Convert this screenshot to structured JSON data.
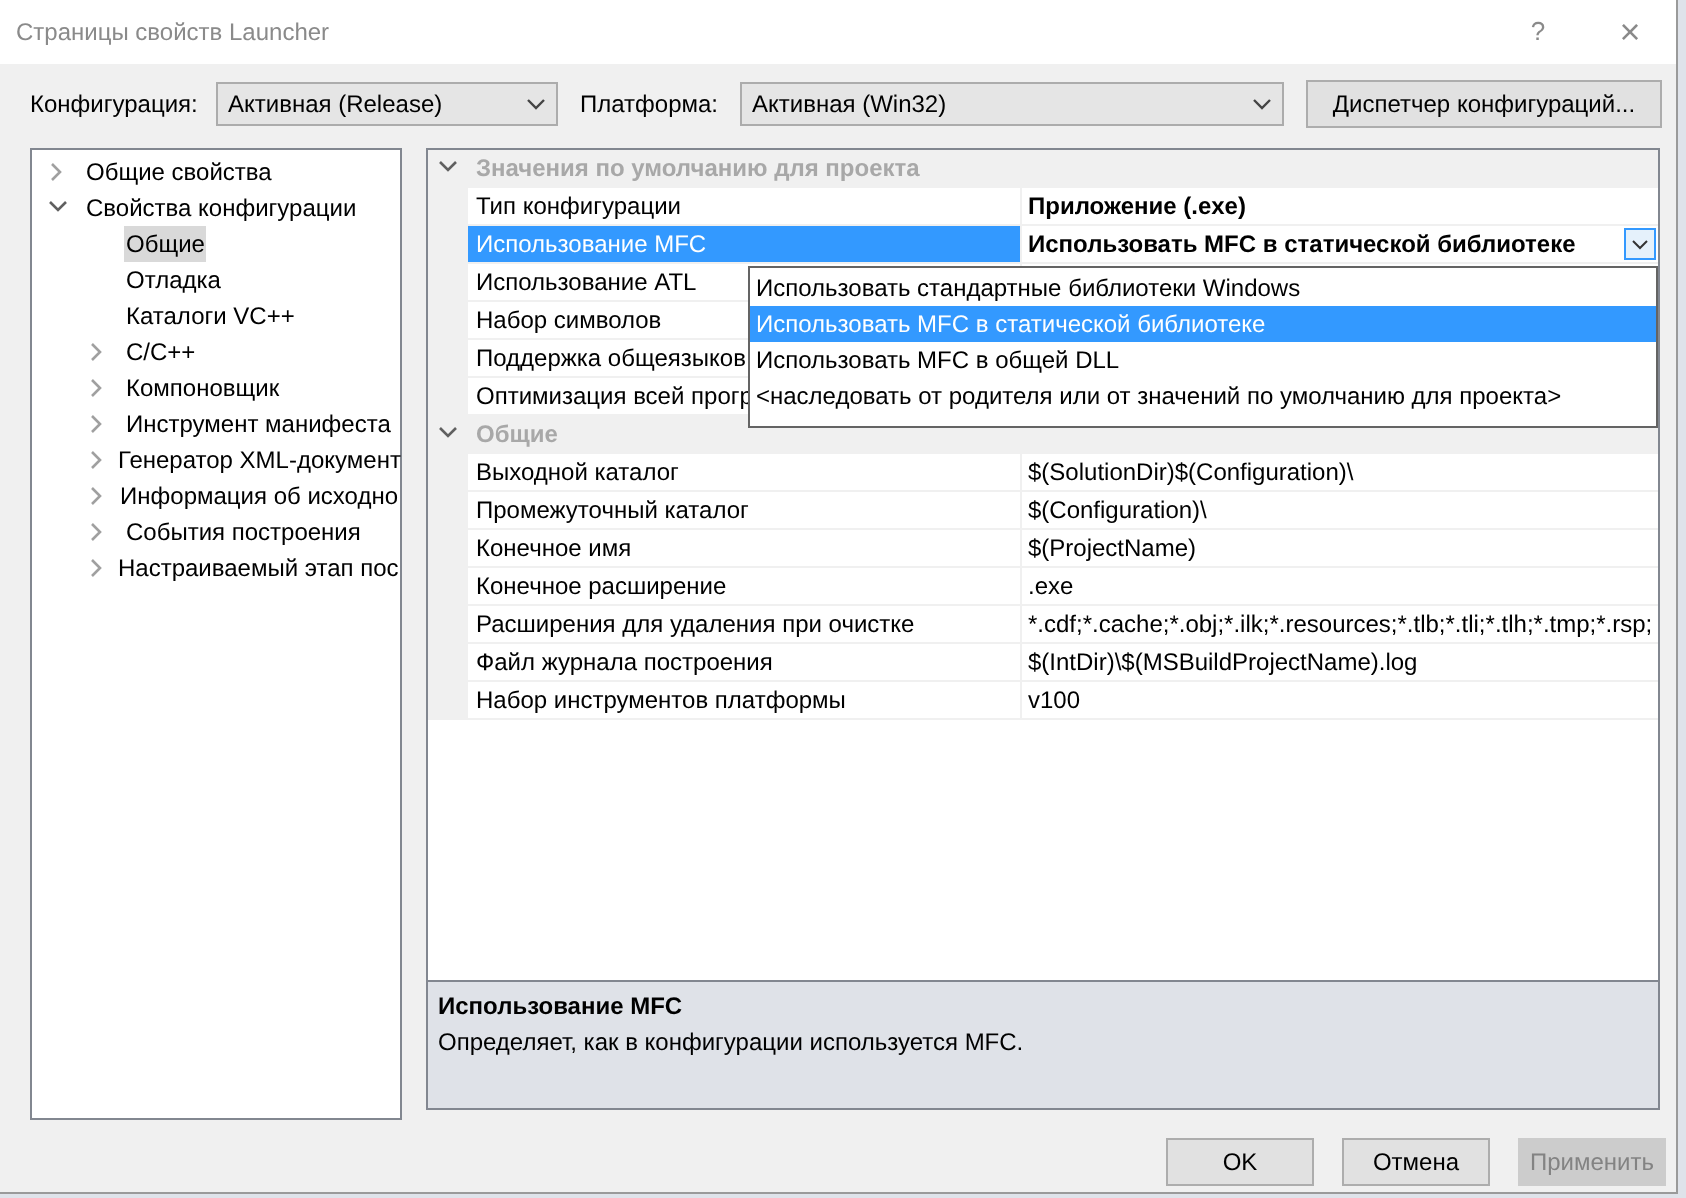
{
  "window": {
    "title": "Страницы свойств Launcher",
    "help": "?",
    "close": "×"
  },
  "toolbar": {
    "configuration_label": "Конфигурация:",
    "configuration": "Активная (Release)",
    "platform_label": "Платформа:",
    "platform": "Активная (Win32)",
    "manager_button": "Диспетчер конфигураций..."
  },
  "tree": [
    {
      "label": "Общие свойства",
      "expanded": false,
      "selected": false
    },
    {
      "label": "Свойства конфигурации",
      "expanded": true,
      "selected": false,
      "children": [
        {
          "label": "Общие",
          "selected": true
        },
        {
          "label": "Отладка",
          "selected": false
        },
        {
          "label": "Каталоги VC++",
          "selected": false
        },
        {
          "label": "C/C++",
          "expanded": false,
          "selected": false
        },
        {
          "label": "Компоновщик",
          "expanded": false,
          "selected": false
        },
        {
          "label": "Инструмент манифеста",
          "expanded": false,
          "selected": false
        },
        {
          "label": "Генератор XML-документ",
          "expanded": false,
          "selected": false
        },
        {
          "label": "Информация об исходно",
          "expanded": false,
          "selected": false
        },
        {
          "label": "События построения",
          "expanded": false,
          "selected": false
        },
        {
          "label": "Настраиваемый этап пос",
          "expanded": false,
          "selected": false
        }
      ]
    }
  ],
  "property_grid": {
    "sections": [
      {
        "title": "Значения по умолчанию для проекта",
        "expanded": true,
        "rows": [
          {
            "name": "Тип конфигурации",
            "value": "Приложение (.exe)",
            "modified": true,
            "selected": false
          },
          {
            "name": "Использование MFC",
            "value": "Использовать MFC в статической библиотеке",
            "modified": true,
            "selected": true
          },
          {
            "name": "Использование ATL",
            "selected": false
          },
          {
            "name": "Набор символов",
            "selected": false
          },
          {
            "name": "Поддержка общеязыков",
            "selected": false
          },
          {
            "name": "Оптимизация всей прогр",
            "selected": false
          }
        ]
      },
      {
        "title": "Общие",
        "expanded": true,
        "rows": [
          {
            "name": "Выходной каталог",
            "value": "$(SolutionDir)$(Configuration)\\",
            "modified": false,
            "selected": false
          },
          {
            "name": "Промежуточный каталог",
            "value": "$(Configuration)\\",
            "modified": false,
            "selected": false
          },
          {
            "name": "Конечное имя",
            "value": "$(ProjectName)",
            "modified": false,
            "selected": false
          },
          {
            "name": "Конечное расширение",
            "value": ".exe",
            "modified": false,
            "selected": false
          },
          {
            "name": "Расширения для удаления при очистке",
            "value": "*.cdf;*.cache;*.obj;*.ilk;*.resources;*.tlb;*.tli;*.tlh;*.tmp;*.rsp;",
            "modified": false,
            "selected": false
          },
          {
            "name": "Файл журнала построения",
            "value": "$(IntDir)\\$(MSBuildProjectName).log",
            "modified": false,
            "selected": false
          },
          {
            "name": "Набор инструментов платформы",
            "value": "v100",
            "modified": false,
            "selected": false
          }
        ]
      }
    ],
    "dropdown": {
      "options": [
        {
          "label": "Использовать стандартные библиотеки Windows",
          "selected": false
        },
        {
          "label": "Использовать MFC в статической библиотеке",
          "selected": true
        },
        {
          "label": "Использовать MFC в общей DLL",
          "selected": false
        },
        {
          "label": "<наследовать от родителя или от значений по умолчанию для проекта>",
          "selected": false
        }
      ]
    }
  },
  "description": {
    "title": "Использование MFC",
    "text": "Определяет, как в конфигурации используется MFC."
  },
  "buttons": [
    {
      "label": "OK",
      "disabled": false
    },
    {
      "label": "Отмена",
      "disabled": false
    },
    {
      "label": "Применить",
      "disabled": true
    }
  ]
}
